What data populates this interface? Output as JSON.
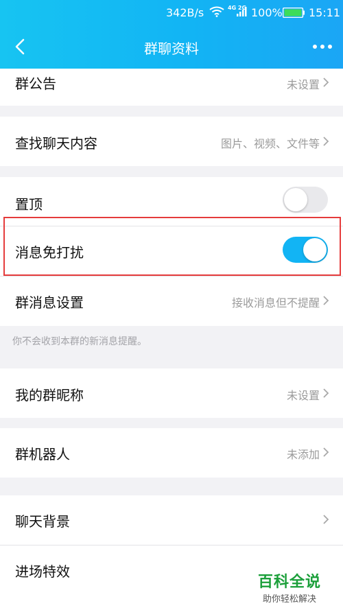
{
  "status": {
    "net_speed": "342B/s",
    "network_type": "4G 2G",
    "battery": "100%",
    "time": "15:11",
    "icons": [
      "wifi-icon",
      "signal-icon",
      "battery-icon"
    ]
  },
  "nav": {
    "title": "群聊资料",
    "back_icon": "chevron-left-icon",
    "more_icon": "more-dots-icon"
  },
  "rows": {
    "announcement": {
      "label": "群公告",
      "value": "未设置"
    },
    "search_chat": {
      "label": "查找聊天内容",
      "value": "图片、视频、文件等"
    },
    "pin_top": {
      "label": "置顶",
      "on": false
    },
    "mute": {
      "label": "消息免打扰",
      "on": true
    },
    "msg_settings": {
      "label": "群消息设置",
      "value": "接收消息但不提醒"
    },
    "nickname": {
      "label": "我的群昵称",
      "value": "未设置"
    },
    "robot": {
      "label": "群机器人",
      "value": "未添加"
    },
    "background": {
      "label": "聊天背景"
    },
    "entry_effect": {
      "label": "进场特效"
    }
  },
  "hint": "你不会收到本群的新消息提醒。",
  "watermark": {
    "main": "百科全说",
    "sub": "助你轻松解决"
  },
  "colors": {
    "header": "#12b4f4",
    "switch_on": "#12b4f4",
    "switch_off": "#e9e9ec",
    "highlight": "#e53b3b"
  }
}
